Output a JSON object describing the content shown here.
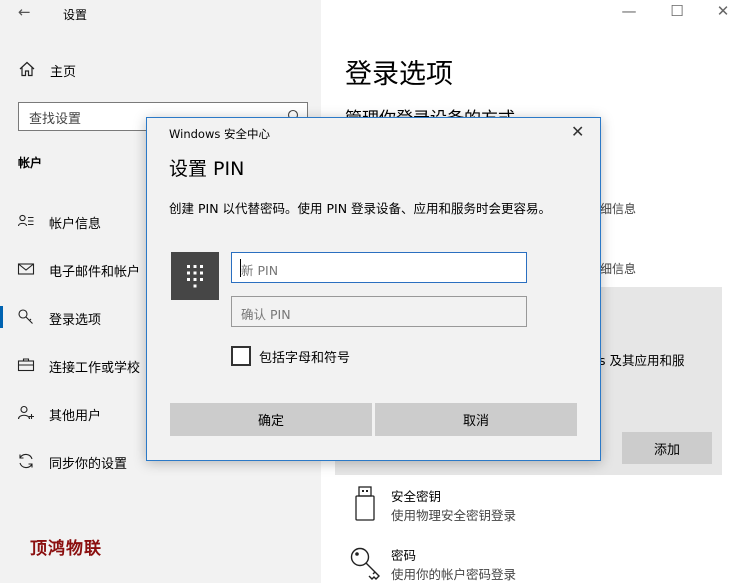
{
  "window": {
    "title": "设置",
    "minimize": "—",
    "maximize": "☐",
    "close": "✕"
  },
  "sidebar": {
    "home_label": "主页",
    "search_placeholder": "查找设置",
    "section_title": "帐户",
    "items": [
      {
        "label": "帐户信息",
        "icon": "account-info-icon"
      },
      {
        "label": "电子邮件和帐户",
        "icon": "email-icon"
      },
      {
        "label": "登录选项",
        "icon": "key-icon",
        "active": true
      },
      {
        "label": "连接工作或学校",
        "icon": "briefcase-icon"
      },
      {
        "label": "其他用户",
        "icon": "add-person-icon"
      },
      {
        "label": "同步你的设置",
        "icon": "sync-icon"
      }
    ],
    "watermark": "顶鸿物联"
  },
  "main": {
    "title": "登录选项",
    "subtitle": "管理你登录设备的方式",
    "detail_1": "细信息",
    "detail_2": "细信息",
    "pin_card_text": "s 及其应用和服",
    "add_button": "添加",
    "options": [
      {
        "title": "安全密钥",
        "desc": "使用物理安全密钥登录",
        "icon": "usb-key-icon"
      },
      {
        "title": "密码",
        "desc": "使用你的帐户密码登录",
        "icon": "password-key-icon"
      }
    ]
  },
  "dialog": {
    "caption": "Windows 安全中心",
    "close": "✕",
    "title": "设置 PIN",
    "description": "创建 PIN 以代替密码。使用 PIN 登录设备、应用和服务时会更容易。",
    "new_pin_placeholder": "新 PIN",
    "confirm_pin_placeholder": "确认 PIN",
    "checkbox_label": "包括字母和符号",
    "checkbox_checked": false,
    "ok_button": "确定",
    "cancel_button": "取消"
  }
}
